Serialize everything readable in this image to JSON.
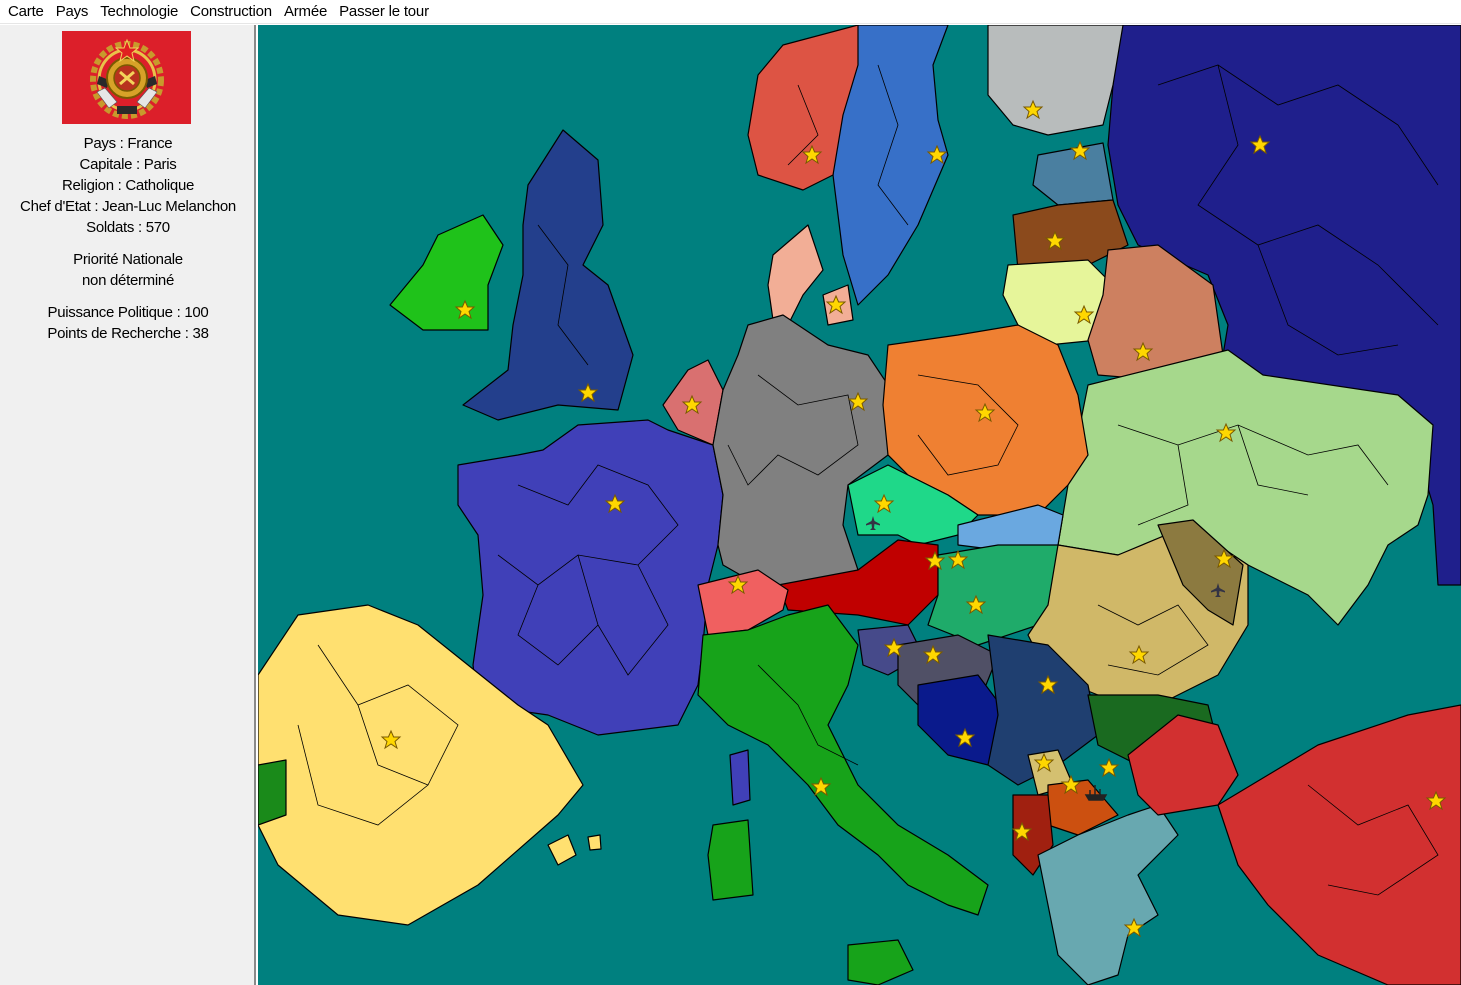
{
  "menu": {
    "items": [
      "Carte",
      "Pays",
      "Technologie",
      "Construction",
      "Armée",
      "Passer le tour"
    ]
  },
  "country_panel": {
    "flag_icon": "ussr-style-emblem-flag",
    "flag_color": "#dc1f2a",
    "pays": "Pays : France",
    "capitale": "Capitale : Paris",
    "religion": "Religion : Catholique",
    "chef": "Chef d'Etat : Jean-Luc Melanchon",
    "soldats": "Soldats : 570",
    "priorite_title": "Priorité Nationale",
    "priorite_value": "non déterminé",
    "puissance": "Puissance Politique : 100",
    "recherche": "Points de Recherche : 38"
  },
  "map": {
    "sea_color": "#00807f",
    "capital_marker": "star-icon",
    "unit_marker": "airplane-icon",
    "naval_marker": "ship-icon"
  }
}
